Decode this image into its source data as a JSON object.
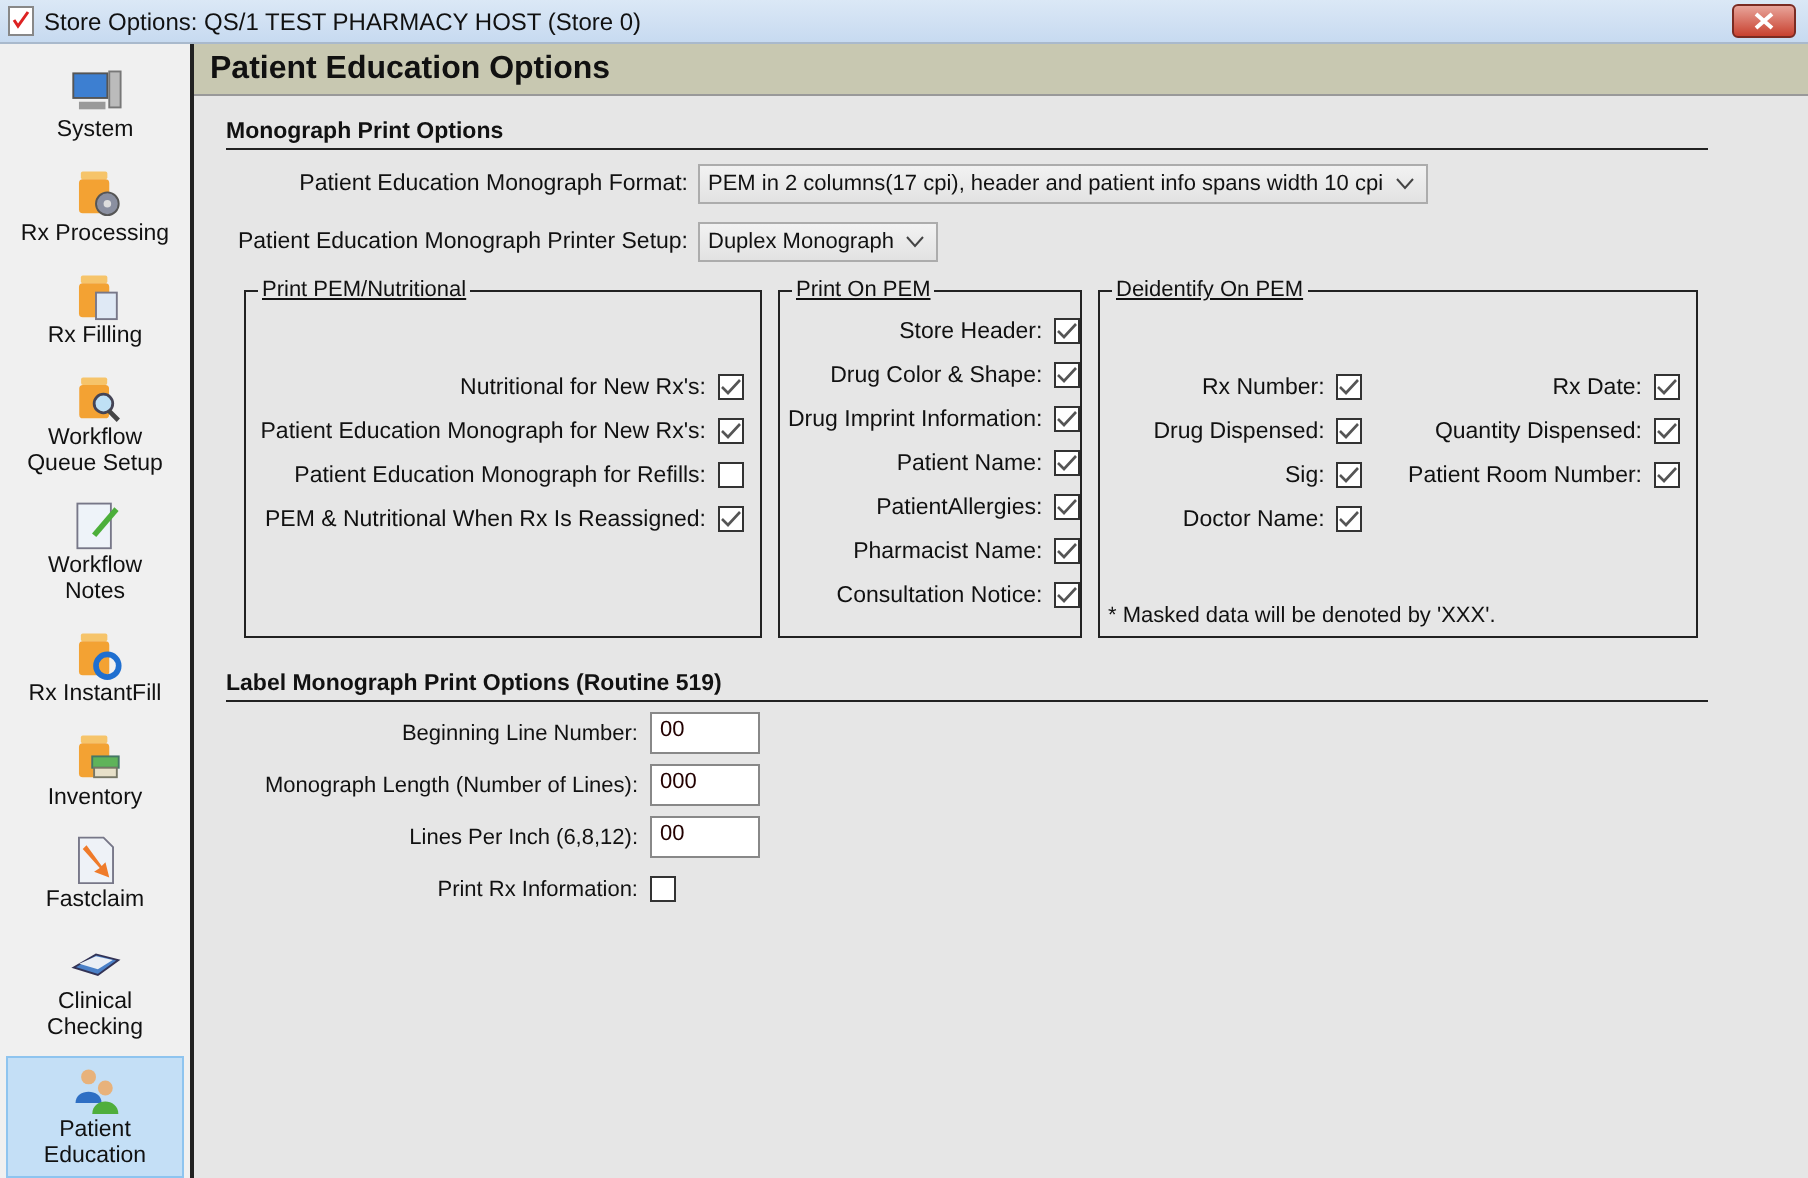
{
  "window": {
    "title": "Store Options: QS/1 TEST PHARMACY HOST (Store 0)"
  },
  "sidebar": {
    "items": [
      {
        "label": "System",
        "selected": false
      },
      {
        "label": "Rx Processing",
        "selected": false
      },
      {
        "label": "Rx Filling",
        "selected": false
      },
      {
        "label": "Workflow Queue Setup",
        "selected": false
      },
      {
        "label": "Workflow Notes",
        "selected": false
      },
      {
        "label": "Rx InstantFill",
        "selected": false
      },
      {
        "label": "Inventory",
        "selected": false
      },
      {
        "label": "Fastclaim",
        "selected": false
      },
      {
        "label": "Clinical Checking",
        "selected": false
      },
      {
        "label": "Patient Education",
        "selected": true
      }
    ]
  },
  "page_title": "Patient Education Options",
  "monograph_print_options": {
    "heading": "Monograph Print Options",
    "fields": [
      {
        "label": "Patient Education Monograph Format:",
        "value": "PEM in 2 columns(17 cpi), header and patient info spans width 10 cpi"
      },
      {
        "label": "Patient Education Monograph Printer Setup:",
        "value": "Duplex Monograph"
      }
    ]
  },
  "groups": [
    {
      "title": "Print PEM/Nutritional",
      "columns": [
        [
          {
            "label": "Nutritional for New Rx's:",
            "checked": true
          },
          {
            "label": "Patient Education Monograph for New Rx's:",
            "checked": true
          },
          {
            "label": "Patient Education Monograph for Refills:",
            "checked": false
          },
          {
            "label": "PEM & Nutritional When Rx Is Reassigned:",
            "checked": true
          }
        ]
      ]
    },
    {
      "title": "Print On PEM",
      "columns": [
        [
          {
            "label": "Store Header:",
            "checked": true
          },
          {
            "label": "Drug Color & Shape:",
            "checked": true
          },
          {
            "label": "Drug Imprint Information:",
            "checked": true
          },
          {
            "label": "Patient Name:",
            "checked": true
          },
          {
            "label": "PatientAllergies:",
            "checked": true
          },
          {
            "label": "Pharmacist Name:",
            "checked": true
          },
          {
            "label": "Consultation Notice:",
            "checked": true
          }
        ]
      ]
    },
    {
      "title": "Deidentify On PEM",
      "columns": [
        [
          {
            "label": "Rx Number:",
            "checked": true
          },
          {
            "label": "Drug Dispensed:",
            "checked": true
          },
          {
            "label": "Sig:",
            "checked": true
          },
          {
            "label": "Doctor Name:",
            "checked": true
          }
        ],
        [
          {
            "label": "Rx Date:",
            "checked": true
          },
          {
            "label": "Quantity Dispensed:",
            "checked": true
          },
          {
            "label": "Patient Room Number:",
            "checked": true
          }
        ]
      ],
      "note": "* Masked data will be denoted by 'XXX'."
    }
  ],
  "label_monograph_print_options": {
    "heading": "Label Monograph Print Options (Routine 519)",
    "rows": [
      {
        "kind": "text",
        "label": "Beginning Line Number:",
        "value": "00"
      },
      {
        "kind": "text",
        "label": "Monograph Length (Number of Lines):",
        "value": "000"
      },
      {
        "kind": "text",
        "label": "Lines Per Inch (6,8,12):",
        "value": "00"
      },
      {
        "kind": "checkbox",
        "label": "Print Rx Information:",
        "checked": false
      }
    ]
  }
}
